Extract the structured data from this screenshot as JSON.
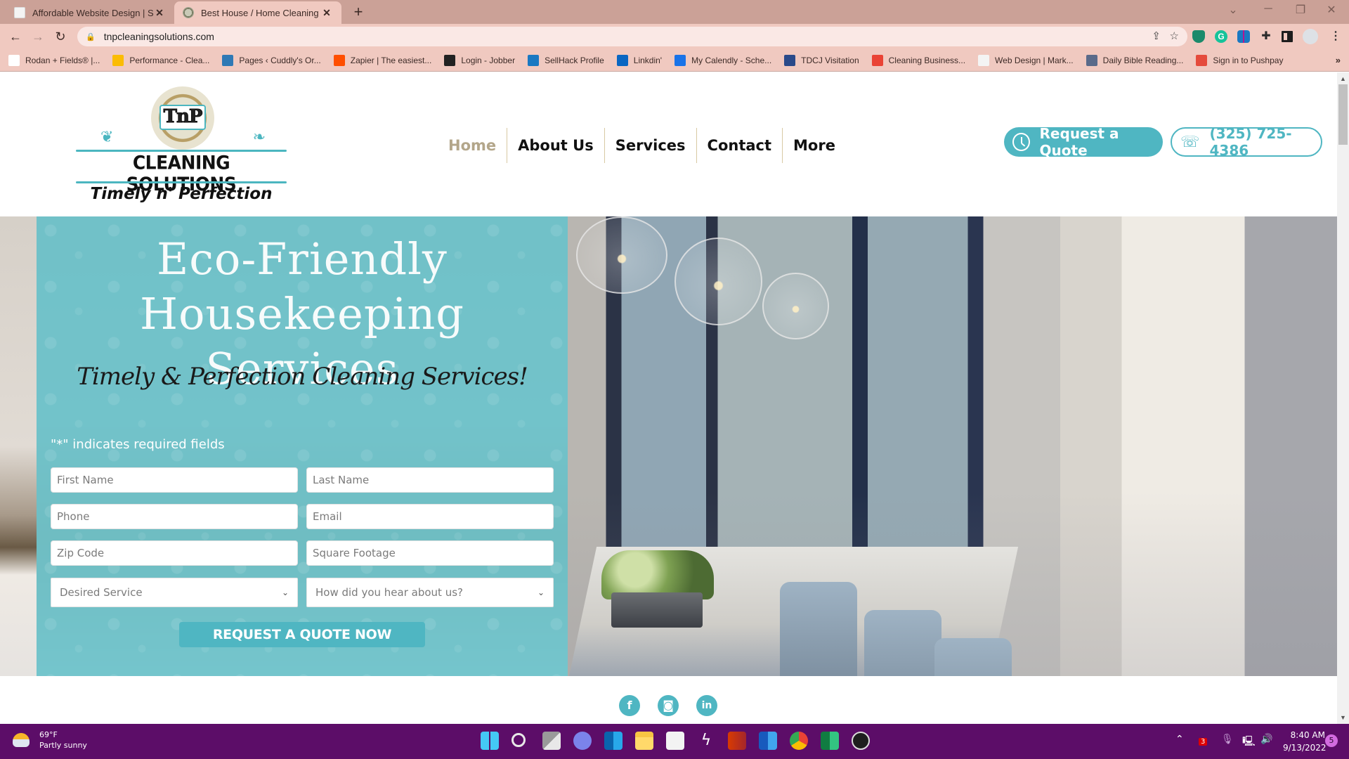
{
  "browser": {
    "tabs": [
      {
        "title": "Affordable Website Design | Sma",
        "favicon": "website-favicon",
        "active": false
      },
      {
        "title": "Best House / Home Cleaning & M",
        "favicon": "tnp-clock-favicon",
        "active": true
      }
    ],
    "new_tab_label": "+",
    "close_glyph": "✕",
    "url": "tnpcleaningsolutions.com",
    "bookmarks": [
      {
        "label": "Rodan + Fields® |...",
        "icon": "rodan-fields-icon",
        "color": "#ffffff"
      },
      {
        "label": "Performance - Clea...",
        "icon": "google-ads-icon",
        "color": "#fbbc04"
      },
      {
        "label": "Pages ‹ Cuddly's Or...",
        "icon": "wordpress-icon",
        "color": "#2f79b5"
      },
      {
        "label": "Zapier | The easiest...",
        "icon": "zapier-icon",
        "color": "#ff4f00"
      },
      {
        "label": "Login - Jobber",
        "icon": "jobber-icon",
        "color": "#222222"
      },
      {
        "label": "SellHack Profile",
        "icon": "sellhack-icon",
        "color": "#1a78c2"
      },
      {
        "label": "Linkdin'",
        "icon": "linkedin-bookmark-icon",
        "color": "#0a66c2"
      },
      {
        "label": "My Calendly - Sche...",
        "icon": "calendly-icon",
        "color": "#1a73e8"
      },
      {
        "label": "TDCJ Visitation",
        "icon": "tdcj-star-icon",
        "color": "#2a4a8a"
      },
      {
        "label": "Cleaning Business...",
        "icon": "google-icon",
        "color": "#ea4335"
      },
      {
        "label": "Web Design | Mark...",
        "icon": "website-favicon",
        "color": "#f4f4f4"
      },
      {
        "label": "Daily Bible Reading...",
        "icon": "bible-icon",
        "color": "#5a6a8a"
      },
      {
        "label": "Sign in to Pushpay",
        "icon": "pushpay-icon",
        "color": "#e54b3c"
      }
    ],
    "bookmarks_more": "»"
  },
  "site": {
    "logo": {
      "monogram": "TnP",
      "name": "CLEANING SOLUTIONS",
      "tagline": "Timely n' Perfection"
    },
    "nav": [
      {
        "label": "Home",
        "active": true
      },
      {
        "label": "About Us",
        "active": false
      },
      {
        "label": "Services",
        "active": false
      },
      {
        "label": "Contact",
        "active": false
      },
      {
        "label": "More",
        "active": false
      }
    ],
    "cta_quote": "Request a Quote",
    "cta_phone": "(325) 725-4386",
    "hero": {
      "title_line1": "Eco-Friendly",
      "title_line2": "Housekeeping Services",
      "subtitle": "Timely & Perfection Cleaning Services!",
      "required_note": "\"*\" indicates required fields",
      "fields": {
        "first_name": "First Name",
        "last_name": "Last Name",
        "phone": "Phone",
        "email": "Email",
        "zip": "Zip Code",
        "sqft": "Square Footage"
      },
      "selects": {
        "service": "Desired Service",
        "referral": "How did you hear about us?"
      },
      "submit": "REQUEST A QUOTE NOW"
    },
    "social": [
      {
        "label": "f",
        "name": "facebook-icon"
      },
      {
        "label": "◙",
        "name": "instagram-icon"
      },
      {
        "label": "in",
        "name": "linkedin-icon"
      }
    ]
  },
  "colors": {
    "brand_teal": "#4fb6c2",
    "nav_active": "#b3a68a",
    "tabbar": "#cba197",
    "taskbar": "#5c0d68"
  },
  "taskbar": {
    "weather_temp": "69°F",
    "weather_desc": "Partly sunny",
    "apps": [
      "start",
      "search",
      "task-view",
      "teams-chat",
      "outlook",
      "file-explorer",
      "microsoft-store",
      "app-bolt",
      "office",
      "word",
      "chrome",
      "excel",
      "obs"
    ],
    "tray_badge": "3",
    "time": "8:40 AM",
    "date": "9/13/2022",
    "notifications": "5"
  }
}
